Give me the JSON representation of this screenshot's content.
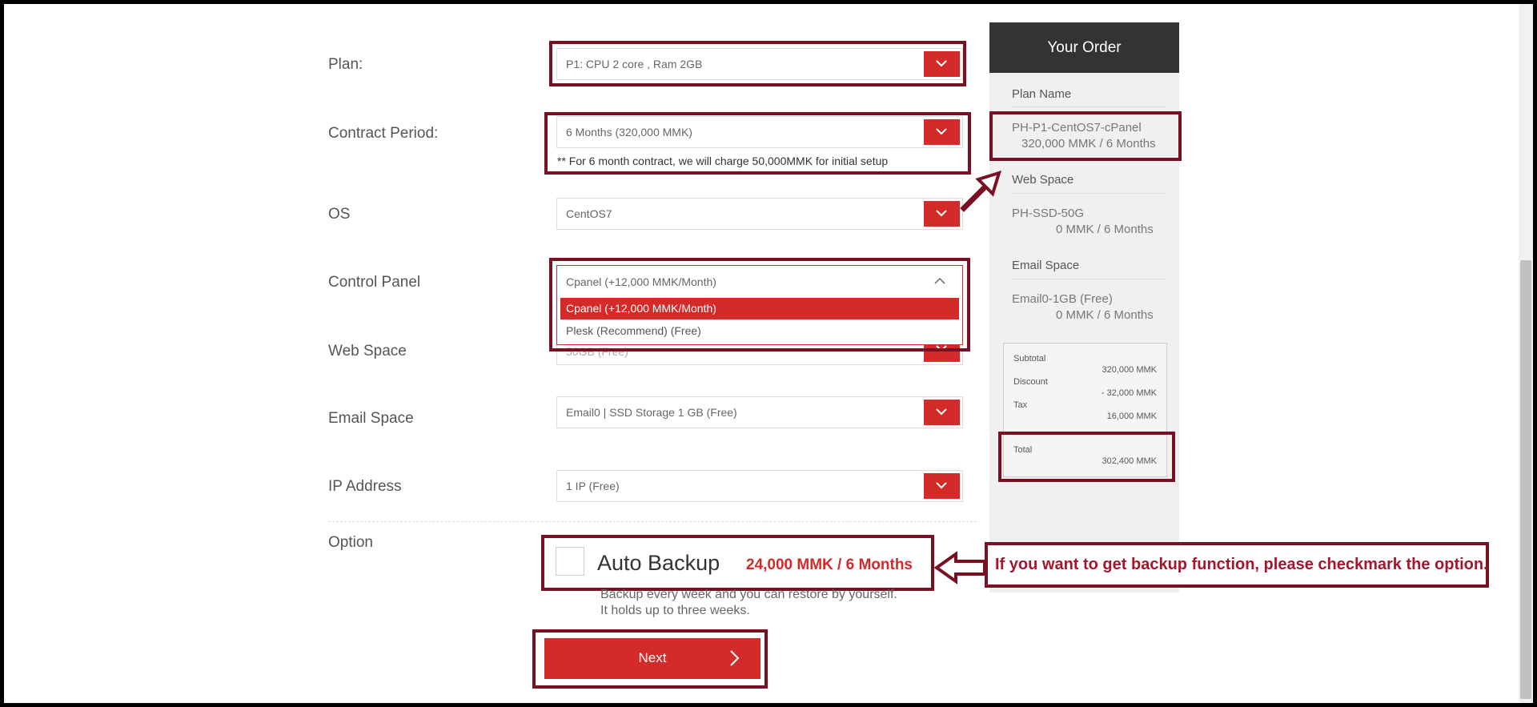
{
  "form": {
    "plan_label": "Plan:",
    "plan_value": "P1: CPU 2 core , Ram 2GB",
    "contract_label": "Contract Period:",
    "contract_value": "6 Months (320,000 MMK)",
    "contract_note": "** For 6 month contract, we will charge 50,000MMK for initial setup",
    "os_label": "OS",
    "os_value": "CentOS7",
    "control_panel_label": "Control Panel",
    "control_panel_value": "Cpanel (+12,000 MMK/Month)",
    "control_panel_options": [
      "Cpanel (+12,000 MMK/Month)",
      "Plesk (Recommend) (Free)"
    ],
    "web_space_label": "Web Space",
    "web_space_value": "50GB (Free)",
    "email_space_label": "Email Space",
    "email_space_value": "Email0 | SSD Storage 1 GB (Free)",
    "ip_label": "IP Address",
    "ip_value": "1 IP (Free)",
    "option_label": "Option",
    "auto_backup_label": "Auto Backup",
    "auto_backup_price": "24,000 MMK / 6 Months",
    "auto_backup_checked": false,
    "auto_backup_desc_1": "Backup every week and you can restore by yourself.",
    "auto_backup_desc_2": "It holds up to three weeks.",
    "next_label": "Next"
  },
  "order": {
    "title": "Your Order",
    "plan_name_label": "Plan Name",
    "plan_name": "PH-P1-CentOS7-cPanel",
    "plan_price": "320,000 MMK / 6 Months",
    "web_space_label": "Web Space",
    "web_space_name": "PH-SSD-50G",
    "web_space_price": "0 MMK / 6 Months",
    "email_space_label": "Email Space",
    "email_space_name": "Email0-1GB (Free)",
    "email_space_price": "0 MMK / 6 Months",
    "subtotal_label": "Subtotal",
    "subtotal_value": "320,000 MMK",
    "discount_label": "Discount",
    "discount_value": "- 32,000 MMK",
    "tax_label": "Tax",
    "tax_value": "16,000 MMK",
    "total_label": "Total",
    "total_value": "302,400 MMK"
  },
  "annotation": {
    "note": "If you want to get backup function, please checkmark the option."
  },
  "colors": {
    "accent": "#d42a2a",
    "highlight": "#7a1024",
    "sidebar_header": "#333333"
  }
}
